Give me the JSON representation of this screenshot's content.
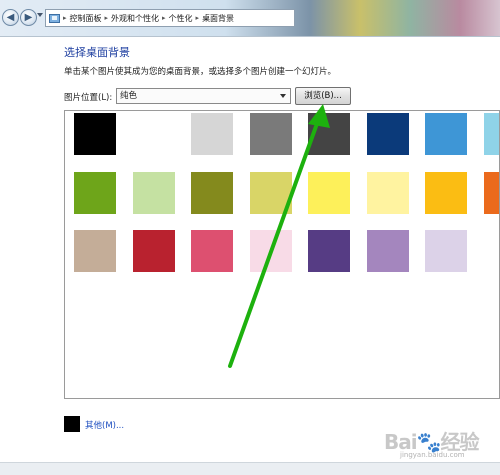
{
  "nav": {
    "back_icon": "back-arrow-icon",
    "forward_icon": "forward-arrow-icon",
    "history_icon": "chevron-down-icon",
    "location_icon": "control-panel-icon",
    "breadcrumbs": [
      "控制面板",
      "外观和个性化",
      "个性化",
      "桌面背景"
    ],
    "separator": "▸"
  },
  "main": {
    "title": "选择桌面背景",
    "subtitle": "单击某个图片使其成为您的桌面背景，或选择多个图片创建一个幻灯片。",
    "location_label": "图片位置(L):",
    "location_value": "纯色",
    "browse_label": "浏览(B)...",
    "other_label": "其他(M)..."
  },
  "swatches": {
    "columns": [
      0,
      1,
      2,
      3,
      4,
      5,
      6,
      7
    ],
    "rows": [
      [
        "#000000",
        "#ffffff",
        "#d6d6d6",
        "#7a7a7a",
        "#444444",
        "#0b3a7a",
        "#3e96d6",
        "#8fd3e8"
      ],
      [
        "#6ea51a",
        "#c5e1a2",
        "#848a1d",
        "#d9d567",
        "#fdf05a",
        "#fff3a0",
        "#fbbd13",
        "#eb6a1c"
      ],
      [
        "#c4ad98",
        "#b9222f",
        "#dd5070",
        "#f8dbe7",
        "#563c84",
        "#a486be",
        "#dcd2e8"
      ]
    ],
    "other_swatch_color": "#000000"
  },
  "colors": {
    "heading": "#1e3fa0",
    "link": "#1e4fc0",
    "annotation_arrow": "#1db10e"
  },
  "watermark": {
    "logo": "Bai🐾经验",
    "url": "jingyan.baidu.com"
  }
}
